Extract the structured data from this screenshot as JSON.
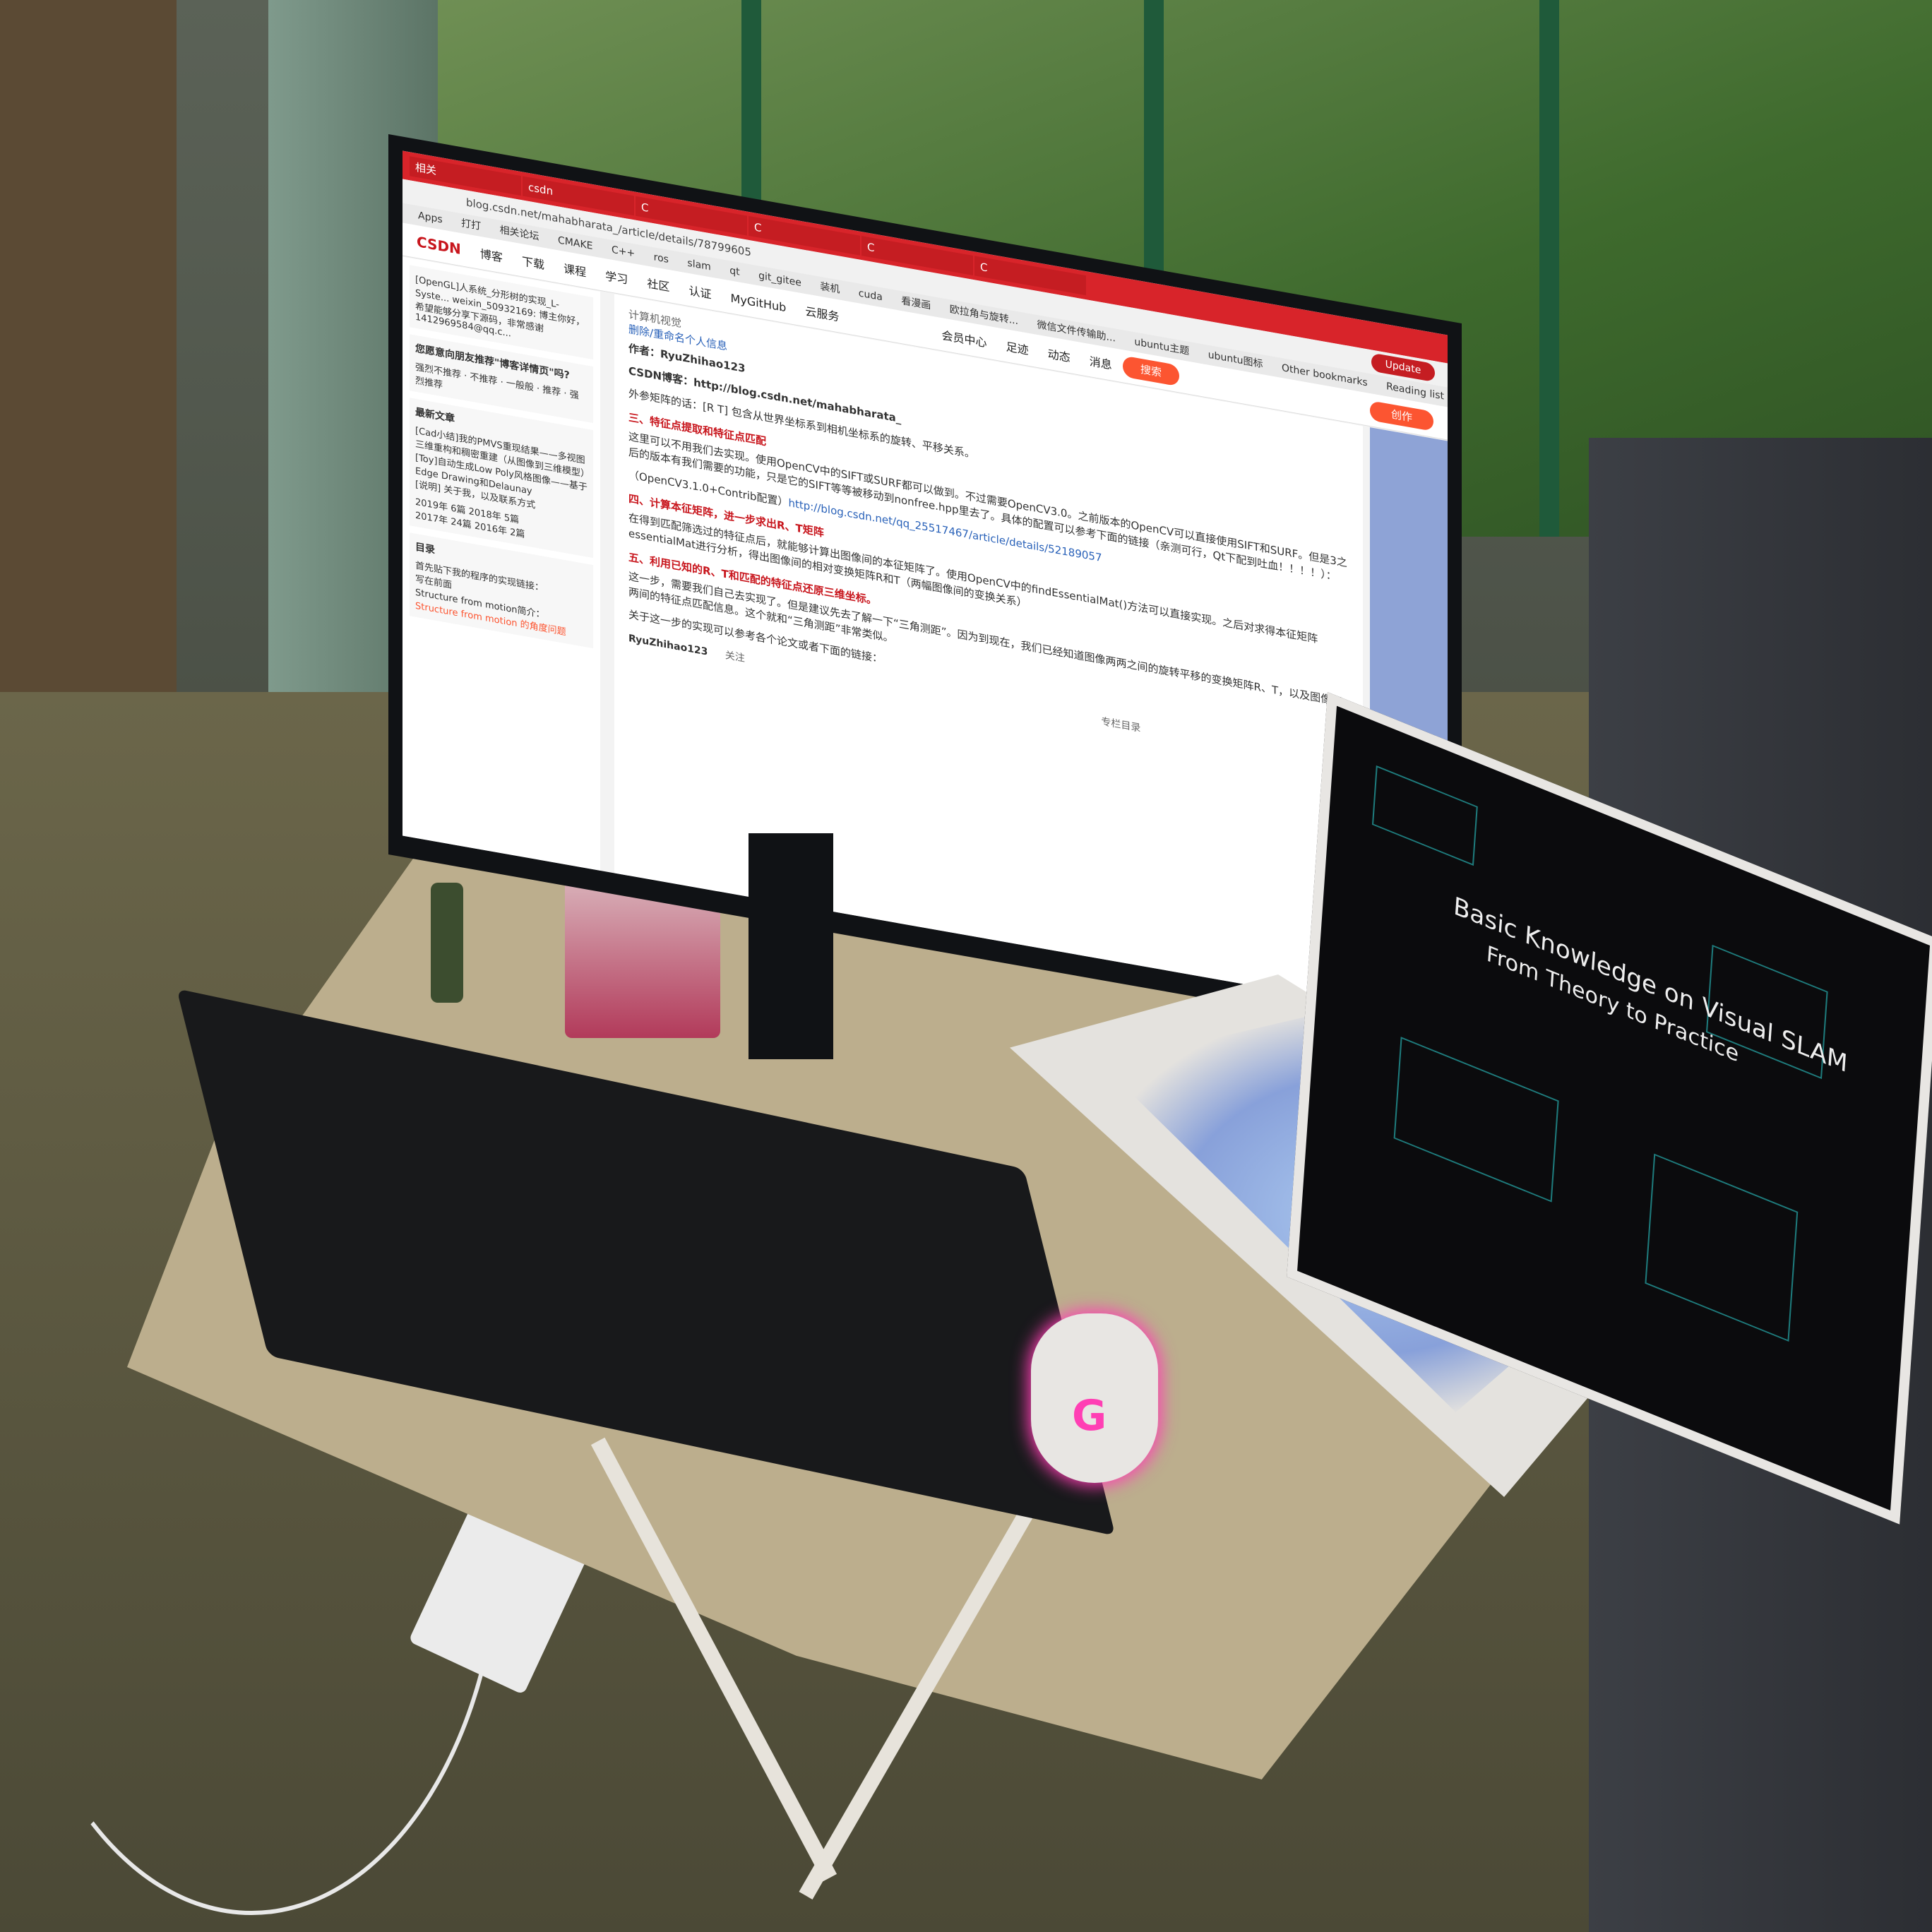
{
  "browser": {
    "tabs": [
      "相关",
      "csdn",
      "C",
      "C",
      "C",
      "C"
    ],
    "url": "blog.csdn.net/mahabharata_/article/details/78799605",
    "bookmarks": [
      "Apps",
      "打打",
      "相关论坛",
      "CMAKE",
      "C++",
      "ros",
      "slam",
      "qt",
      "git_gitee",
      "装机",
      "cuda",
      "看漫画",
      "欧拉角与旋转...",
      "微信文件传输助...",
      "ubuntu主题",
      "ubuntu图标",
      "Other bookmarks",
      "Reading list"
    ],
    "update_label": "Update"
  },
  "csdn": {
    "logo": "CSDN",
    "nav": [
      "博客",
      "下载",
      "课程",
      "学习",
      "社区",
      "认证",
      "MyGitHub",
      "云服务"
    ],
    "search_button": "搜索",
    "user_items": [
      "会员中心",
      "足迹",
      "动态",
      "消息"
    ],
    "create_button": "创作"
  },
  "sidebar": {
    "box1_text": "[OpenGL]人系统_分形树的实现_L-Syste... weixin_50932169: 博主你好，希望能够分享下源码，非常感谢 1412969584@qq.c...",
    "feedback_title": "您愿意向朋友推荐\"博客详情页\"吗?",
    "feedback_options": [
      "强烈不推荐",
      "不推荐",
      "一般般",
      "推荐",
      "强烈推荐"
    ],
    "recent_title": "最新文章",
    "recent_items": [
      "[Cad小结]我的PMVS重现结果——多视图三维重构和稠密重建（从图像到三维模型）",
      "[Toy]自动生成Low Poly风格图像——基于Edge Drawing和Delaunay",
      "[说明] 关于我，以及联系方式"
    ],
    "archive": [
      "2019年 6篇",
      "2018年 5篇",
      "2017年 24篇",
      "2016年 2篇"
    ],
    "toc_title": "目录",
    "toc_items": [
      "首先贴下我的程序的实现链接：",
      "写在前面",
      "Structure from motion简介：",
      "Structure from motion 的角度问题"
    ]
  },
  "article": {
    "link_top": "删除/重命名个人信息",
    "author_line": "作者：RyuZhihao123",
    "blog_line": "CSDN博客：http://blog.csdn.net/mahabharata_",
    "p1": "外参矩阵的话：[R T] 包含从世界坐标系到相机坐标系的旋转、平移关系。",
    "h3": "三、特征点提取和特征点匹配",
    "p2": "这里可以不用我们去实现。使用OpenCV中的SIFT或SURF都可以做到。不过需要OpenCV3.0。之前版本的OpenCV可以直接使用SIFT和SURF。但是3之后的版本有我们需要的功能，只是它的SIFT等等被移动到nonfree.hpp里去了。具体的配置可以参考下面的链接（亲测可行，Qt下配到吐血！！！！）：",
    "p3_prefix": "（OpenCV3.1.0+Contrib配置）",
    "p3_link": "http://blog.csdn.net/qq_25517467/article/details/52189057",
    "h4": "四、计算本征矩阵，进一步求出R、T矩阵",
    "p4": "在得到匹配筛选过的特征点后，就能够计算出图像间的本征矩阵了。使用OpenCV中的findEssentialMat()方法可以直接实现。之后对求得本征矩阵essentialMat进行分析，得出图像间的相对变换矩阵R和T（两幅图像间的变换关系）",
    "h5": "五、利用已知的R、T和匹配的特征点还原三维坐标。",
    "p5": "这一步，需要我们自己去实现了。但是建议先去了解一下“三角测距”。因为到现在，我们已经知道图像两两之间的旋转平移的变换矩阵R、T，以及图像两两间的特征点匹配信息。这个就和“三角测距”非常类似。",
    "p6": "关于这一步的实现可以参考各个论文或者下面的链接：",
    "footer_author": "RyuZhihao123",
    "footer_follow": "关注",
    "catalog_button": "专栏目录",
    "subtitle": "计算机视觉"
  },
  "laptop": {
    "title_line1": "Basic Knowledge on Visual SLAM",
    "title_line2": "From Theory to Practice"
  },
  "colors": {
    "csdn_red": "#d8242a",
    "accent": "#fc5531",
    "mouse_glow": "#ff3fb4",
    "keyboard_glow": "#3d6bd6"
  }
}
